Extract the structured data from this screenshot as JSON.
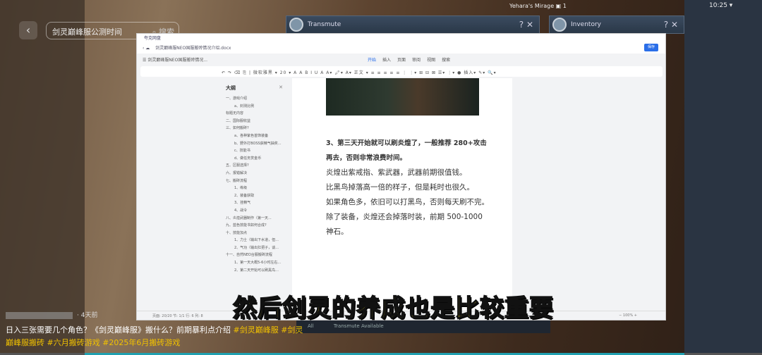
{
  "search": {
    "query": "剑灵巅峰服公测时间",
    "button": "搜索"
  },
  "game": {
    "transmute_title": "Transmute",
    "inventory_title": "Inventory",
    "help": "?",
    "close": "✕",
    "location": "Yehara's Mirage",
    "channel": "1",
    "time": "10:25",
    "bottom_tabs": [
      "All",
      "Transmute Available"
    ]
  },
  "doc": {
    "app": "夸克网盘",
    "filename": "剑灵巅峰服NEO国服搬砖情况介绍.docx",
    "short_title": "剑灵巅峰服NEO国服搬砖情况...",
    "save": "保存",
    "tabs": [
      "开始",
      "插入",
      "页面",
      "审阅",
      "视图",
      "搜索"
    ],
    "active_tab": "开始",
    "toolbar": "↶ ↷ ⌫ ⎘ | 微软雅黑 ▾ 20 ▾ A A B I U A A▾ 🖍▾ A▾ 正文 ▾ ≡ ≡ ≡ ≡ ≡ ⋮ ⋮▾ ⊞ ⊟ ⊠ ☰▾ ⋮▾ ● 插入▾ ✎▾ 🔍▾",
    "outline": {
      "title": "大纲",
      "items": [
        "一、游戏介绍",
        "a、封测比例",
        "标题无内容",
        "二、国际服收益",
        "三、如何搬砖?",
        "a、各种紫色首饰装备",
        "b、野外打BOSS获精气抽奖...",
        "c、技能书",
        "d、做任务赏金币",
        "五、区服选择?",
        "六、报错解决",
        "七、搬砖流程",
        "1、练级",
        "2、装备获取",
        "3、挂精气",
        "4、战令",
        "八、炎煌武器制作（第一天...",
        "九、蓝色技能书如何合成?",
        "十、技能加点",
        "1、力士（输出下水道，但...",
        "2、气功（输出扛把子，谈...",
        "十一、自然NEO台服搬砖流程",
        "1、第一天大概5-6小时左右...",
        "2、第二天开始可以刷黑鸟..."
      ]
    },
    "paragraphs": [
      "3、第三天开始就可以刷炎煌了，一般推荐 280+攻击",
      "再去，否则非常浪费时间。",
      "炎煌出紫戒指、紫武器，武器前期很值钱。",
      "比黑鸟掉落高一倍的样子，但是耗时也很久。",
      "如果角色多，依旧可以打黑鸟，否则每天刷不完。",
      "除了装备，炎煌还会掉落时装，前期 500-1000",
      "神石。"
    ],
    "status": "页面: 20/20   节: 1/1   行: 6   列: 8",
    "zoom": "100%"
  },
  "subtitle": "然后剑灵的养成也是比较重要",
  "post": {
    "age": "· 4天前",
    "caption": "日入三张需要几个角色？《剑灵巅峰服》搬什么？前期暴利点介绍",
    "tags": [
      "#剑灵巅峰服",
      "#剑灵巅峰服搬砖",
      "#六月搬砖游戏",
      "#2025年6月搬砖游戏"
    ]
  },
  "colors": {
    "accent": "#2a6ee8",
    "subtitle": "#f7e21a",
    "tag": "#f2c200"
  }
}
